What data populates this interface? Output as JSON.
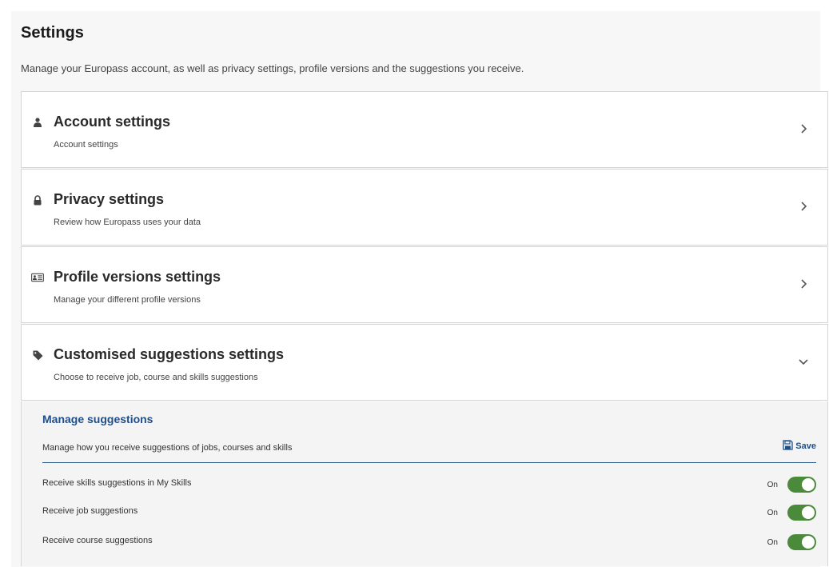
{
  "page": {
    "title": "Settings",
    "description": "Manage your Europass account, as well as privacy settings, profile versions and the suggestions you receive."
  },
  "panels": [
    {
      "title": "Account settings",
      "subtitle": "Account settings",
      "icon": "person-icon",
      "state": "collapsed"
    },
    {
      "title": "Privacy settings",
      "subtitle": "Review how Europass uses your data",
      "icon": "lock-icon",
      "state": "collapsed"
    },
    {
      "title": "Profile versions settings",
      "subtitle": "Manage your different profile versions",
      "icon": "id-card-icon",
      "state": "collapsed"
    },
    {
      "title": "Customised suggestions settings",
      "subtitle": "Choose to receive job, course and skills suggestions",
      "icon": "tag-icon",
      "state": "expanded"
    }
  ],
  "manage_suggestions": {
    "title": "Manage suggestions",
    "description": "Manage how you receive suggestions of jobs, courses and skills",
    "save_label": "Save",
    "toggles": [
      {
        "label": "Receive skills suggestions in My Skills",
        "state": "On",
        "enabled": true
      },
      {
        "label": "Receive job suggestions",
        "state": "On",
        "enabled": true
      },
      {
        "label": "Receive course suggestions",
        "state": "On",
        "enabled": true
      }
    ]
  },
  "colors": {
    "accent": "#1f4e8a",
    "toggle_on": "#4a8a3a",
    "background": "#f7f7f7"
  }
}
